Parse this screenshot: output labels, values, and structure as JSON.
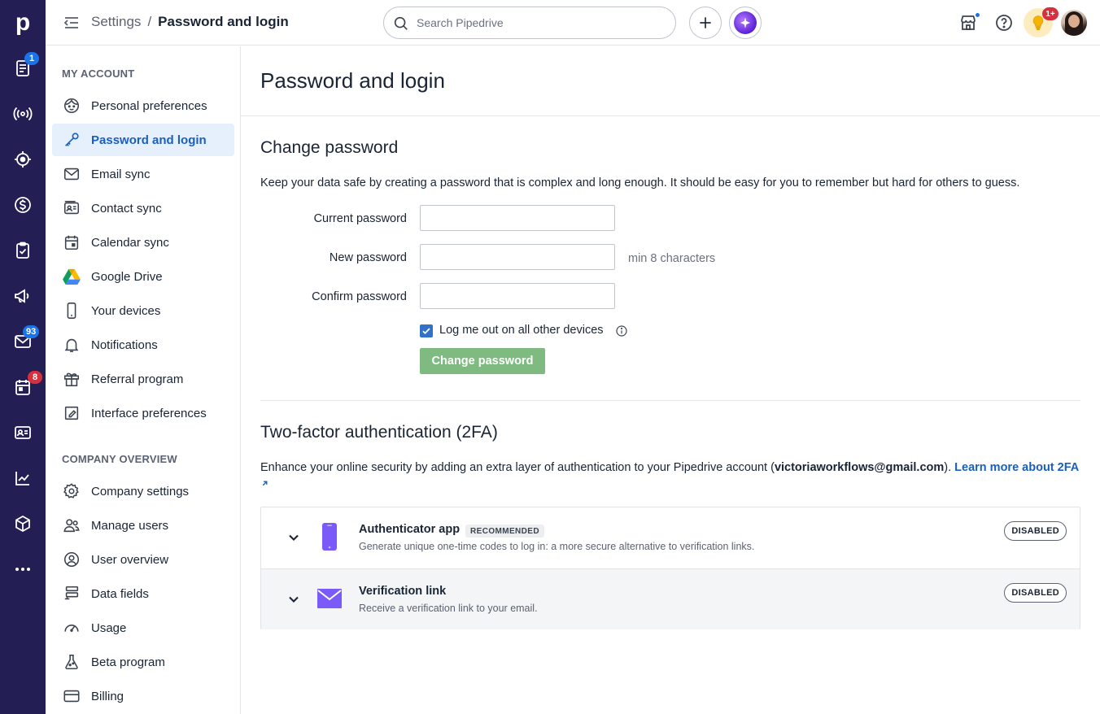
{
  "topbar": {
    "breadcrumb_parent": "Settings",
    "breadcrumb_separator": "/",
    "breadcrumb_current": "Password and login",
    "search_placeholder": "Search Pipedrive",
    "notifications_badge": "1+"
  },
  "rail": {
    "logo": "p",
    "badges": {
      "leads": "1",
      "mail": "93",
      "activities": "8"
    },
    "items": [
      "leads-icon",
      "radar-icon",
      "target-icon",
      "deals-icon",
      "projects-icon",
      "campaigns-icon",
      "mail-icon",
      "activities-icon",
      "contacts-icon",
      "insights-icon",
      "products-icon",
      "more-icon"
    ]
  },
  "sidebar": {
    "my_account_title": "MY ACCOUNT",
    "my_account": [
      {
        "label": "Personal preferences",
        "icon": "face-icon"
      },
      {
        "label": "Password and login",
        "icon": "key-icon",
        "active": true
      },
      {
        "label": "Email sync",
        "icon": "envelope-icon"
      },
      {
        "label": "Contact sync",
        "icon": "contact-card-icon"
      },
      {
        "label": "Calendar sync",
        "icon": "calendar-icon"
      },
      {
        "label": "Google Drive",
        "icon": "google-drive-icon"
      },
      {
        "label": "Your devices",
        "icon": "phone-icon"
      },
      {
        "label": "Notifications",
        "icon": "bell-icon"
      },
      {
        "label": "Referral program",
        "icon": "gift-icon"
      },
      {
        "label": "Interface preferences",
        "icon": "edit-square-icon"
      }
    ],
    "company_title": "COMPANY OVERVIEW",
    "company": [
      {
        "label": "Company settings",
        "icon": "gear-icon"
      },
      {
        "label": "Manage users",
        "icon": "users-icon"
      },
      {
        "label": "User overview",
        "icon": "user-circle-icon"
      },
      {
        "label": "Data fields",
        "icon": "data-fields-icon"
      },
      {
        "label": "Usage",
        "icon": "gauge-icon"
      },
      {
        "label": "Beta program",
        "icon": "flask-icon"
      },
      {
        "label": "Billing",
        "icon": "credit-card-icon"
      }
    ]
  },
  "main": {
    "title": "Password and login",
    "change_password": {
      "heading": "Change password",
      "description": "Keep your data safe by creating a password that is complex and long enough. It should be easy for you to remember but hard for others to guess.",
      "current_label": "Current password",
      "new_label": "New password",
      "new_hint": "min 8 characters",
      "confirm_label": "Confirm password",
      "logout_label": "Log me out on all other devices",
      "logout_checked": true,
      "button": "Change password"
    },
    "tfa": {
      "heading": "Two-factor authentication (2FA)",
      "desc_prefix": "Enhance your online security by adding an extra layer of authentication to your Pipedrive account (",
      "email": "victoriaworkflows@gmail.com",
      "desc_suffix": "). ",
      "learn_more": "Learn more about 2FA",
      "methods": [
        {
          "title": "Authenticator app",
          "badge": "RECOMMENDED",
          "subtitle": "Generate unique one-time codes to log in: a more secure alternative to verification links.",
          "status": "DISABLED"
        },
        {
          "title": "Verification link",
          "subtitle": "Receive a verification link to your email.",
          "status": "DISABLED"
        }
      ]
    }
  },
  "colors": {
    "rail_bg": "#231f55",
    "active_bg": "#e6f0fc",
    "active_text": "#1b5fbd",
    "button_green": "#7fbb80",
    "method_icon": "#7a5af8"
  }
}
